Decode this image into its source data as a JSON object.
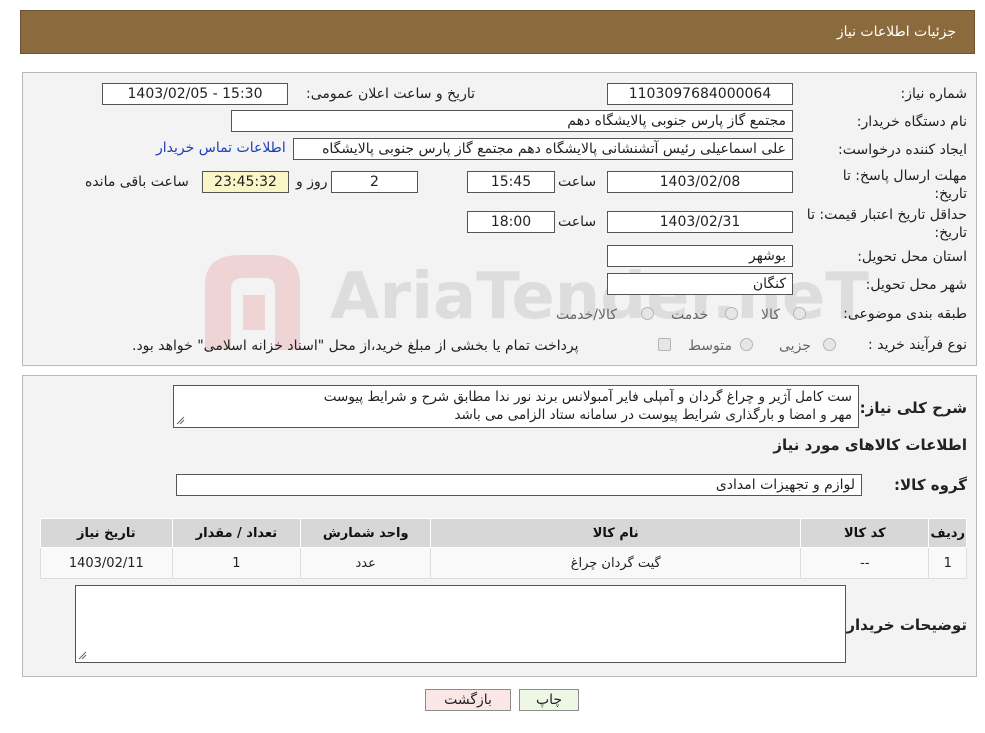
{
  "header": {
    "title": "جزئیات اطلاعات نیاز"
  },
  "need": {
    "number_label": "شماره نیاز:",
    "number": "1103097684000064",
    "announce_label": "تاریخ و ساعت اعلان عمومی:",
    "announce": "1403/02/05 - 15:30",
    "buyer_org_label": "نام دستگاه خریدار:",
    "buyer_org": "مجتمع گاز پارس جنوبی  پالایشگاه دهم",
    "creator_label": "ایجاد کننده درخواست:",
    "creator": "علی اسماعیلی رئیس آتشنشانی پالایشگاه دهم  مجتمع گاز پارس جنوبی  پالایشگاه",
    "contact_link": "اطلاعات تماس خریدار",
    "deadline_label": "مهلت ارسال پاسخ: تا تاریخ:",
    "deadline_date": "1403/02/08",
    "time_label": "ساعت",
    "deadline_time": "15:45",
    "days": "2",
    "days_label": "روز و",
    "remaining": "23:45:32",
    "remaining_label": "ساعت باقی مانده",
    "validity_label": "حداقل تاریخ اعتبار قیمت: تا تاریخ:",
    "validity_date": "1403/02/31",
    "validity_time": "18:00",
    "province_label": "استان محل تحویل:",
    "province": "بوشهر",
    "city_label": "شهر محل تحویل:",
    "city": "کنگان",
    "category_label": "طبقه بندی موضوعی:",
    "category_options": [
      "کالا",
      "خدمت",
      "کالا/خدمت"
    ],
    "process_label": "نوع فرآیند خرید :",
    "process_options": [
      "جزیی",
      "متوسط"
    ],
    "process_note": "پرداخت تمام یا بخشی از مبلغ خرید،از محل \"اسناد خزانه اسلامی\" خواهد بود."
  },
  "summary": {
    "label": "شرح کلی نیاز:",
    "line1": "ست کامل آژیر و چراغ گردان و آمپلی فایر آمبولانس برند نور ندا مطابق شرح و شرایط پیوست",
    "line2": "مهر و امضا و بارگذاری شرایط پیوست در سامانه ستاد الزامی می باشد",
    "goods_title": "اطلاعات کالاهای مورد نیاز",
    "group_label": "گروه کالا:",
    "group": "لوازم و تجهیزات امدادی"
  },
  "table": {
    "headers": [
      "ردیف",
      "کد کالا",
      "نام کالا",
      "واحد شمارش",
      "تعداد / مقدار",
      "تاریخ نیاز"
    ],
    "rows": [
      [
        "1",
        "--",
        "گیت گردان چراغ",
        "عدد",
        "1",
        "1403/02/11"
      ]
    ]
  },
  "buyer_notes_label": "توضیحات خریدار:",
  "buttons": {
    "print": "چاپ",
    "back": "بازگشت"
  },
  "watermark": "AriaTender.neT"
}
